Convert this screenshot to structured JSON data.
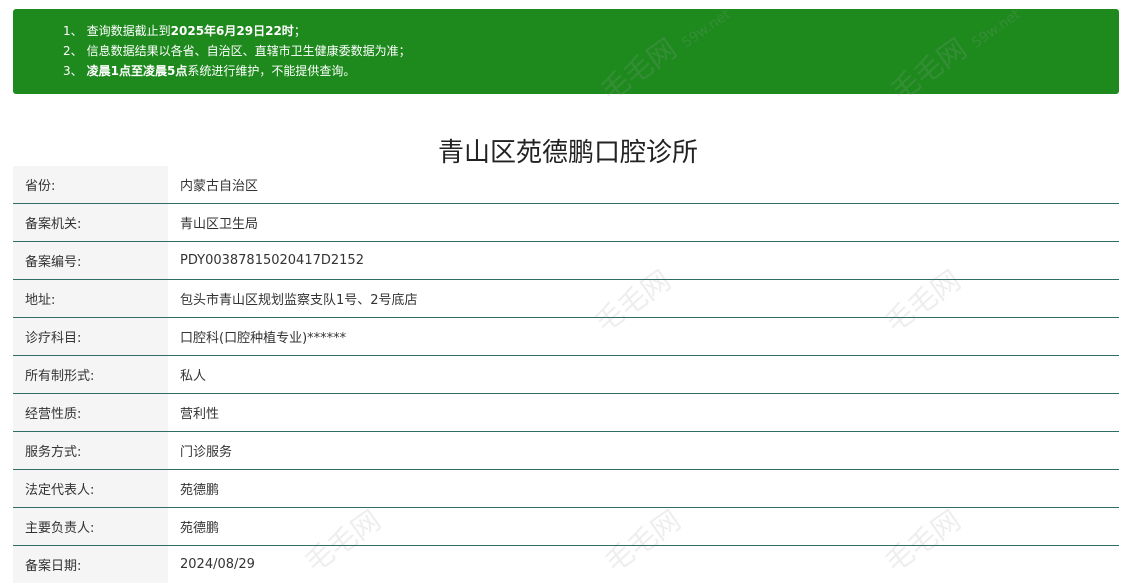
{
  "notice": {
    "lines": [
      {
        "num": "1、",
        "text": "查询数据截止到",
        "bold": "2025年6月29日22时",
        "tail": "；"
      },
      {
        "num": "2、",
        "text": "信息数据结果以各省、自治区、直辖市卫生健康委数据为准；",
        "bold": "",
        "tail": ""
      },
      {
        "num": "3、",
        "text": "",
        "bold": "凌晨1点至凌晨5点",
        "tail": "系统进行维护，不能提供查询。"
      }
    ]
  },
  "page": {
    "title": "青山区苑德鹏口腔诊所"
  },
  "watermark": {
    "text": "毛毛网",
    "url": "59w.net"
  },
  "info": [
    {
      "label": "省份:",
      "value": "内蒙古自治区"
    },
    {
      "label": "备案机关:",
      "value": "青山区卫生局"
    },
    {
      "label": "备案编号:",
      "value": "PDY00387815020417D2152"
    },
    {
      "label": "地址:",
      "value": "包头市青山区规划监察支队1号、2号底店"
    },
    {
      "label": "诊疗科目:",
      "value": "口腔科(口腔种植专业)******"
    },
    {
      "label": "所有制形式:",
      "value": "私人"
    },
    {
      "label": "经营性质:",
      "value": "营利性"
    },
    {
      "label": "服务方式:",
      "value": "门诊服务"
    },
    {
      "label": "法定代表人:",
      "value": "苑德鹏"
    },
    {
      "label": "主要负责人:",
      "value": "苑德鹏"
    },
    {
      "label": "备案日期:",
      "value": "2024/08/29"
    }
  ]
}
